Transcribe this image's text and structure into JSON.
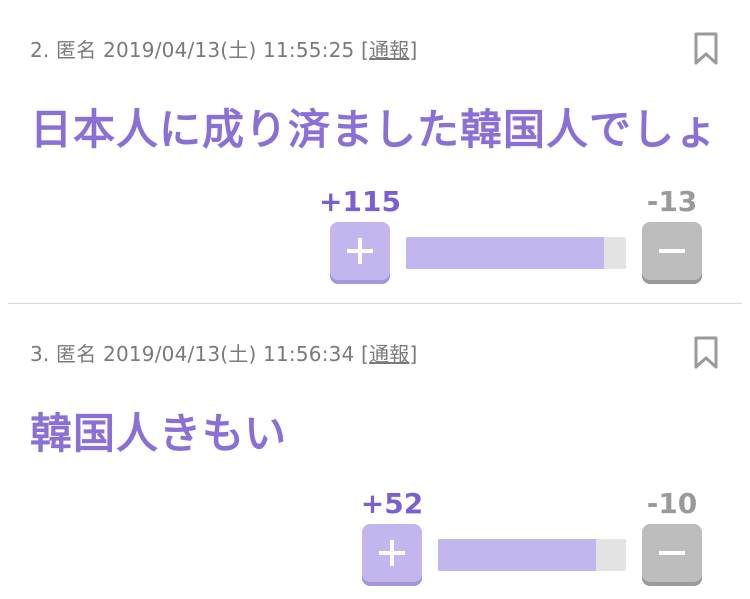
{
  "comments": [
    {
      "number": "2.",
      "author": "匿名",
      "datetime": "2019/04/13(土) 11:55:25",
      "report_open": "[",
      "report_label": "通報",
      "report_close": "]",
      "text": "日本人に成り済ました韓国人でしょ",
      "plus": "+115",
      "minus": "-13",
      "plus_ratio": 0.898
    },
    {
      "number": "3.",
      "author": "匿名",
      "datetime": "2019/04/13(土) 11:56:34",
      "report_open": "[",
      "report_label": "通報",
      "report_close": "]",
      "text": "韓国人きもい",
      "plus": "+52",
      "minus": "-10",
      "plus_ratio": 0.839
    }
  ],
  "icons": {
    "bookmark": "bookmark-icon",
    "plus": "plus-icon",
    "minus": "minus-icon"
  },
  "colors": {
    "accent": "#8a70d6",
    "plus_count": "#7a5fd3",
    "plus_button": "#c3b5ee",
    "minus_button": "#bdbdbd",
    "bar_track": "#e3e3e3"
  }
}
